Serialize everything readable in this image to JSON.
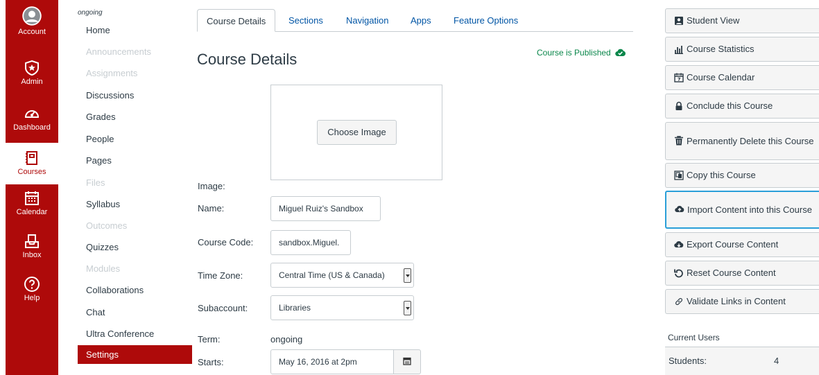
{
  "global_nav": [
    {
      "label": "Account",
      "icon": "account-avatar-icon"
    },
    {
      "label": "Admin",
      "icon": "admin-shield-icon"
    },
    {
      "label": "Dashboard",
      "icon": "dashboard-gauge-icon"
    },
    {
      "label": "Courses",
      "icon": "courses-book-icon"
    },
    {
      "label": "Calendar",
      "icon": "calendar-icon"
    },
    {
      "label": "Inbox",
      "icon": "inbox-icon"
    },
    {
      "label": "Help",
      "icon": "help-question-icon"
    }
  ],
  "course_nav": {
    "term": "ongoing",
    "links": [
      {
        "label": "Home",
        "state": "enabled"
      },
      {
        "label": "Announcements",
        "state": "disabled"
      },
      {
        "label": "Assignments",
        "state": "disabled"
      },
      {
        "label": "Discussions",
        "state": "enabled"
      },
      {
        "label": "Grades",
        "state": "enabled"
      },
      {
        "label": "People",
        "state": "enabled"
      },
      {
        "label": "Pages",
        "state": "enabled"
      },
      {
        "label": "Files",
        "state": "disabled"
      },
      {
        "label": "Syllabus",
        "state": "enabled"
      },
      {
        "label": "Outcomes",
        "state": "disabled"
      },
      {
        "label": "Quizzes",
        "state": "enabled"
      },
      {
        "label": "Modules",
        "state": "disabled"
      },
      {
        "label": "Collaborations",
        "state": "enabled"
      },
      {
        "label": "Chat",
        "state": "enabled"
      },
      {
        "label": "Ultra Conference",
        "state": "enabled"
      },
      {
        "label": "Settings",
        "state": "active"
      }
    ]
  },
  "tabs": [
    "Course Details",
    "Sections",
    "Navigation",
    "Apps",
    "Feature Options"
  ],
  "main": {
    "title": "Course Details",
    "published": "Course is Published",
    "choose_image": "Choose Image",
    "labels": {
      "image": "Image:",
      "name": "Name:",
      "course_code": "Course Code:",
      "time_zone": "Time Zone:",
      "subaccount": "Subaccount:",
      "term": "Term:",
      "starts": "Starts:"
    },
    "values": {
      "name": "Miguel Ruiz's Sandbox",
      "course_code": "sandbox.Miguel.",
      "time_zone": "Central Time (US & Canada)",
      "subaccount": "Libraries",
      "term": "ongoing",
      "starts": "May 16, 2016 at  2pm"
    }
  },
  "sidebar": {
    "buttons": [
      {
        "label": "Student View",
        "icon": "student-view-icon"
      },
      {
        "label": "Course Statistics",
        "icon": "bar-chart-icon"
      },
      {
        "label": "Course Calendar",
        "icon": "calendar-icon"
      },
      {
        "label": "Conclude this Course",
        "icon": "lock-icon"
      },
      {
        "label": "Permanently Delete this Course",
        "icon": "trash-icon"
      },
      {
        "label": "Copy this Course",
        "icon": "copy-icon"
      },
      {
        "label": "Import Content into this Course",
        "icon": "cloud-upload-icon"
      },
      {
        "label": "Export Course Content",
        "icon": "cloud-download-icon"
      },
      {
        "label": "Reset Course Content",
        "icon": "reset-icon"
      },
      {
        "label": "Validate Links in Content",
        "icon": "link-icon"
      }
    ],
    "current_users_title": "Current Users",
    "students_label": "Students:",
    "students_count": "4"
  },
  "colors": {
    "brand_red": "#ae0a0a",
    "link_blue": "#0055a5",
    "published_green": "#0b874b",
    "focus_blue": "#2a9fd8"
  }
}
